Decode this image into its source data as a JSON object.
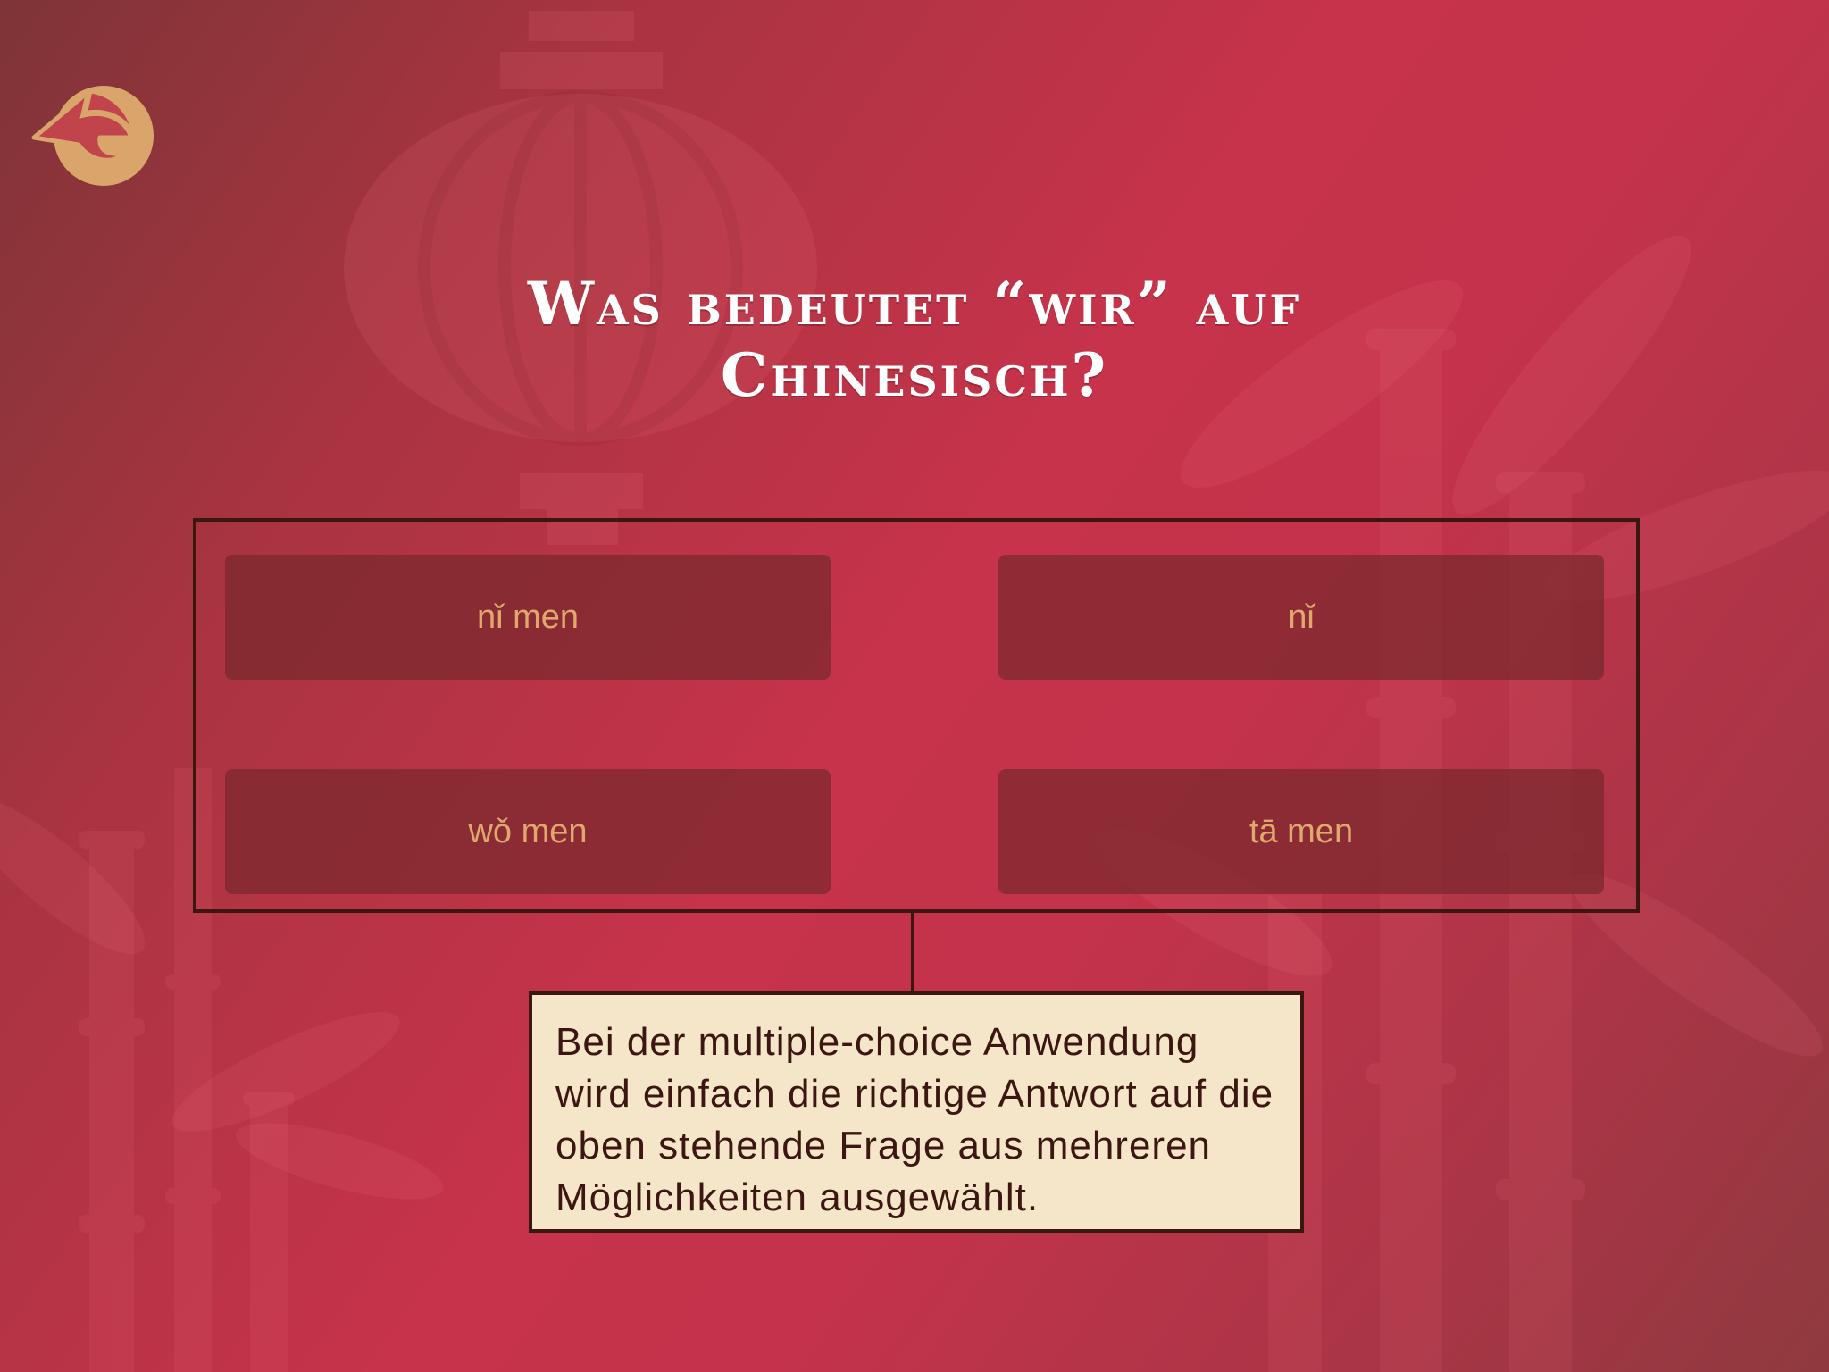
{
  "header": {
    "back_icon": "back-arrow-icon",
    "question": "Was bedeutet “wir” auf Chinesisch?"
  },
  "answers": [
    {
      "label": "nǐ men"
    },
    {
      "label": "nǐ"
    },
    {
      "label": "wǒ men"
    },
    {
      "label": "tā men"
    }
  ],
  "caption": {
    "text": "Bei der multiple-choice Anwendung wird einfach die richtige Antwort auf die oben stehende Frage aus mehreren Möglichkeiten ausgewählt."
  },
  "colors": {
    "background": "#c4334b",
    "button_fill": "#95353e",
    "button_text": "#e0a86c",
    "frame_border": "#3c1711",
    "caption_fill": "#f5e6c9",
    "icon_fill": "#d9a56a"
  }
}
